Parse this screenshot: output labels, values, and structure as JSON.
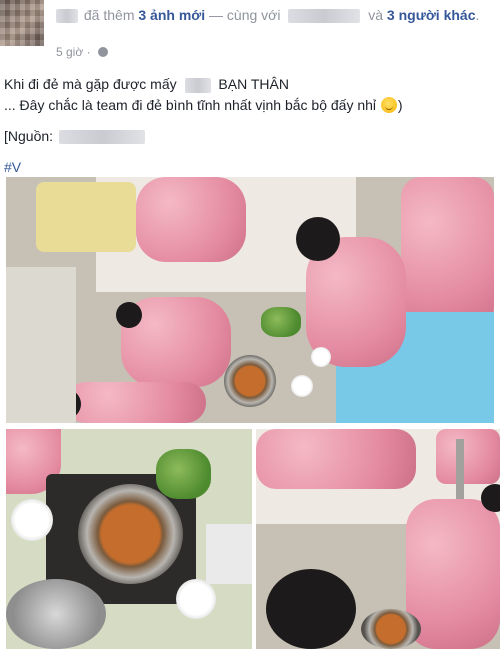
{
  "post": {
    "headline_action": "đã thêm",
    "headline_photos": "3 ảnh mới",
    "headline_with": "— cùng với",
    "headline_and": "và",
    "headline_others": "3 người khác",
    "headline_end": ".",
    "time": "5 giờ",
    "text_line1_a": "Khi đi đẻ mà gặp được mấy",
    "text_line1_b": "BẠN THÂN",
    "text_line2": "... Đây chắc là team đi đẻ bình tĩnh nhất vịnh bắc bộ đấy nhỉ",
    "text_line2_end": ")",
    "source_label": "[Nguồn:",
    "hashtag": "#V"
  },
  "icons": {
    "privacy": "globe-icon",
    "emoji": "smile-emoji-icon"
  },
  "colors": {
    "link": "#365899",
    "meta": "#90949c",
    "text": "#1d2129"
  }
}
